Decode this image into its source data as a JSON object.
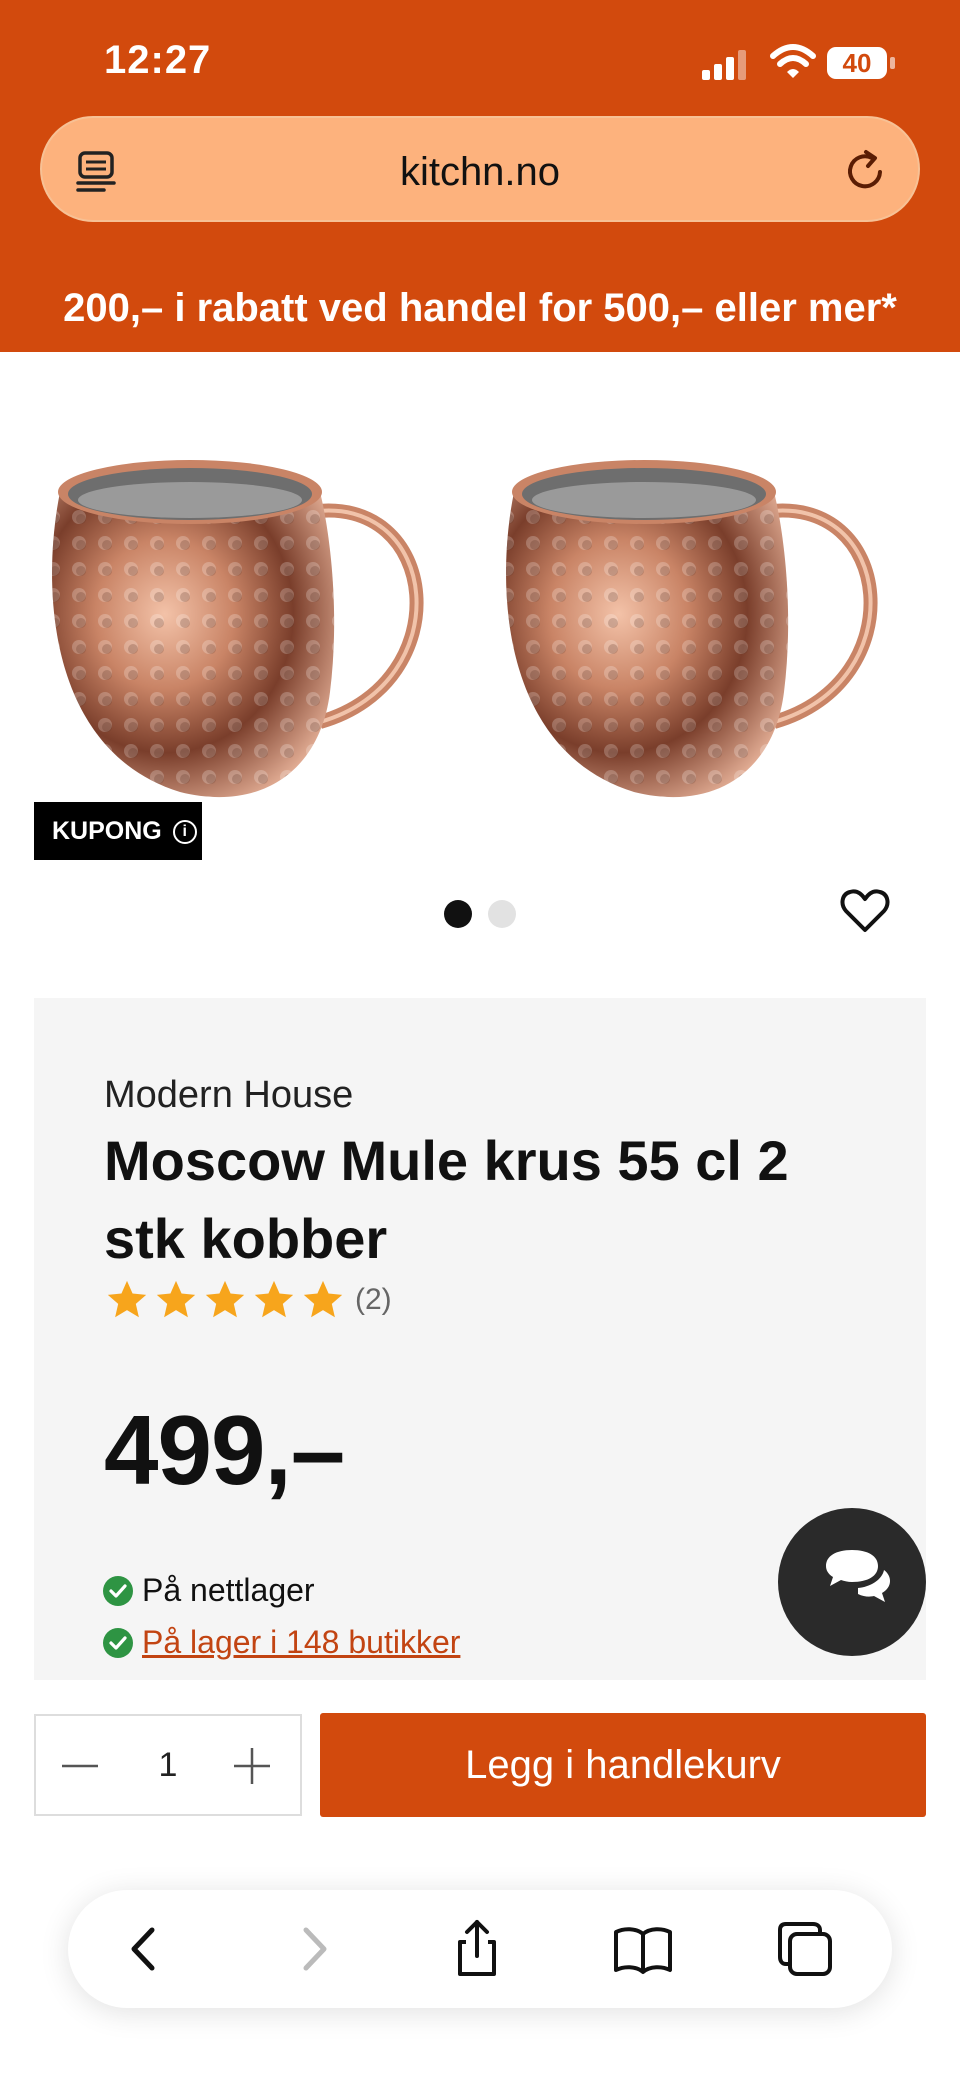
{
  "status_bar": {
    "time": "12:27",
    "battery": "40"
  },
  "browser": {
    "url": "kitchn.no"
  },
  "promo": {
    "text": "200,– i rabatt ved handel for 500,– eller mer*"
  },
  "gallery": {
    "badge": "KUPONG",
    "badge_icon": "info-icon",
    "dots": {
      "count": 2,
      "active": 1
    }
  },
  "product": {
    "brand": "Modern House",
    "title": "Moscow Mule krus 55 cl 2 stk kobber",
    "rating": 5,
    "review_count": "(2)",
    "price": "499,–",
    "stock_online": "På nettlager",
    "stock_stores": "På lager i 148 butikker"
  },
  "cart": {
    "quantity": "1",
    "add_label": "Legg i handlekurv"
  },
  "colors": {
    "brand": "#d24a0d",
    "url_bar": "#fdb27d",
    "check": "#2e9443",
    "star": "#f7a51c",
    "link": "#c24412"
  }
}
